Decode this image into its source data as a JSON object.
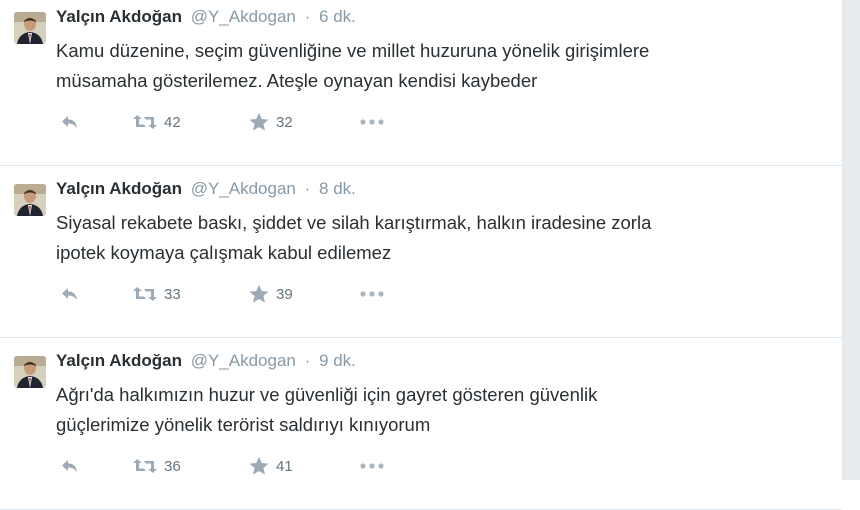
{
  "tweets": [
    {
      "fullname": "Yalçın Akdoğan",
      "username": "@Y_Akdogan",
      "separator": "·",
      "time": "6 dk.",
      "lines": [
        "Kamu düzenine, seçim güvenliğine ve millet huzuruna yönelik girişimlere",
        "müsamaha gösterilemez. Ateşle oynayan kendisi kaybeder"
      ],
      "retweets": "42",
      "favorites": "32"
    },
    {
      "fullname": "Yalçın Akdoğan",
      "username": "@Y_Akdogan",
      "separator": "·",
      "time": "8 dk.",
      "lines": [
        "Siyasal rekabete baskı, şiddet ve silah karıştırmak, halkın iradesine zorla",
        "ipotek koymaya çalışmak kabul edilemez"
      ],
      "retweets": "33",
      "favorites": "39"
    },
    {
      "fullname": "Yalçın Akdoğan",
      "username": "@Y_Akdogan",
      "separator": "·",
      "time": "9 dk.",
      "lines": [
        "Ağrı'da halkımızın huzur ve güvenliği için gayret gösteren güvenlik",
        "güçlerimize yönelik terörist saldırıyı kınıyorum"
      ],
      "retweets": "36",
      "favorites": "41"
    }
  ],
  "icons": {
    "reply": "reply-icon",
    "retweet": "retweet-icon",
    "favorite": "star-icon",
    "more": "more-dots-icon"
  },
  "colors": {
    "text": "#292f33",
    "muted": "#8899a6",
    "divider": "#e1e8ed"
  }
}
